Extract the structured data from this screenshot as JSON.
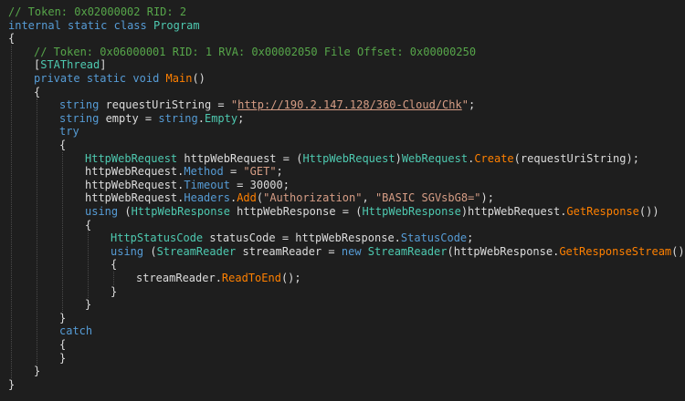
{
  "colors": {
    "background": "#1e1e1e",
    "comment": "#57a64a",
    "keyword": "#569cd6",
    "type": "#4ec9b0",
    "string": "#d69d85",
    "method": "#ff8000",
    "plain": "#dcdcdc"
  },
  "code": {
    "lines": [
      {
        "indent": 0,
        "tokens": [
          {
            "t": "// Token: 0x02000002 RID: 2",
            "c": "comment"
          }
        ]
      },
      {
        "indent": 0,
        "tokens": [
          {
            "t": "internal",
            "c": "keyword"
          },
          {
            "t": " ",
            "c": "plain"
          },
          {
            "t": "static",
            "c": "keyword"
          },
          {
            "t": " ",
            "c": "plain"
          },
          {
            "t": "class",
            "c": "keyword"
          },
          {
            "t": " ",
            "c": "plain"
          },
          {
            "t": "Program",
            "c": "type"
          }
        ]
      },
      {
        "indent": 0,
        "tokens": [
          {
            "t": "{",
            "c": "plain"
          }
        ]
      },
      {
        "indent": 1,
        "tokens": [
          {
            "t": "// Token: 0x06000001 RID: 1 RVA: 0x00002050 File Offset: 0x00000250",
            "c": "comment"
          }
        ]
      },
      {
        "indent": 1,
        "tokens": [
          {
            "t": "[",
            "c": "plain"
          },
          {
            "t": "STAThread",
            "c": "type"
          },
          {
            "t": "]",
            "c": "plain"
          }
        ]
      },
      {
        "indent": 1,
        "tokens": [
          {
            "t": "private",
            "c": "keyword"
          },
          {
            "t": " ",
            "c": "plain"
          },
          {
            "t": "static",
            "c": "keyword"
          },
          {
            "t": " ",
            "c": "plain"
          },
          {
            "t": "void",
            "c": "keyword"
          },
          {
            "t": " ",
            "c": "plain"
          },
          {
            "t": "Main",
            "c": "method"
          },
          {
            "t": "()",
            "c": "plain"
          }
        ]
      },
      {
        "indent": 1,
        "tokens": [
          {
            "t": "{",
            "c": "plain"
          }
        ]
      },
      {
        "indent": 2,
        "tokens": [
          {
            "t": "string",
            "c": "keyword"
          },
          {
            "t": " requestUriString = ",
            "c": "plain"
          },
          {
            "t": "\"",
            "c": "string"
          },
          {
            "t": "http://190.2.147.128/360-Cloud/Chk",
            "c": "url"
          },
          {
            "t": "\"",
            "c": "string"
          },
          {
            "t": ";",
            "c": "plain"
          }
        ]
      },
      {
        "indent": 2,
        "tokens": [
          {
            "t": "string",
            "c": "keyword"
          },
          {
            "t": " empty = ",
            "c": "plain"
          },
          {
            "t": "string",
            "c": "keyword"
          },
          {
            "t": ".",
            "c": "plain"
          },
          {
            "t": "Empty",
            "c": "type"
          },
          {
            "t": ";",
            "c": "plain"
          }
        ]
      },
      {
        "indent": 2,
        "tokens": [
          {
            "t": "try",
            "c": "keyword"
          }
        ]
      },
      {
        "indent": 2,
        "tokens": [
          {
            "t": "{",
            "c": "plain"
          }
        ]
      },
      {
        "indent": 3,
        "tokens": [
          {
            "t": "HttpWebRequest",
            "c": "type"
          },
          {
            "t": " httpWebRequest = (",
            "c": "plain"
          },
          {
            "t": "HttpWebRequest",
            "c": "type"
          },
          {
            "t": ")",
            "c": "plain"
          },
          {
            "t": "WebRequest",
            "c": "type"
          },
          {
            "t": ".",
            "c": "plain"
          },
          {
            "t": "Create",
            "c": "method"
          },
          {
            "t": "(requestUriString);",
            "c": "plain"
          }
        ]
      },
      {
        "indent": 3,
        "tokens": [
          {
            "t": "httpWebRequest.",
            "c": "plain"
          },
          {
            "t": "Method",
            "c": "keyword"
          },
          {
            "t": " = ",
            "c": "plain"
          },
          {
            "t": "\"GET\"",
            "c": "string"
          },
          {
            "t": ";",
            "c": "plain"
          }
        ]
      },
      {
        "indent": 3,
        "tokens": [
          {
            "t": "httpWebRequest.",
            "c": "plain"
          },
          {
            "t": "Timeout",
            "c": "keyword"
          },
          {
            "t": " = 30000;",
            "c": "plain"
          }
        ]
      },
      {
        "indent": 3,
        "tokens": [
          {
            "t": "httpWebRequest.",
            "c": "plain"
          },
          {
            "t": "Headers",
            "c": "keyword"
          },
          {
            "t": ".",
            "c": "plain"
          },
          {
            "t": "Add",
            "c": "method"
          },
          {
            "t": "(",
            "c": "plain"
          },
          {
            "t": "\"Authorization\"",
            "c": "string"
          },
          {
            "t": ", ",
            "c": "plain"
          },
          {
            "t": "\"BASIC SGVsbG8=\"",
            "c": "string"
          },
          {
            "t": ");",
            "c": "plain"
          }
        ]
      },
      {
        "indent": 3,
        "tokens": [
          {
            "t": "using",
            "c": "keyword"
          },
          {
            "t": " (",
            "c": "plain"
          },
          {
            "t": "HttpWebResponse",
            "c": "type"
          },
          {
            "t": " httpWebResponse = (",
            "c": "plain"
          },
          {
            "t": "HttpWebResponse",
            "c": "type"
          },
          {
            "t": ")httpWebRequest.",
            "c": "plain"
          },
          {
            "t": "GetResponse",
            "c": "method"
          },
          {
            "t": "())",
            "c": "plain"
          }
        ]
      },
      {
        "indent": 3,
        "tokens": [
          {
            "t": "{",
            "c": "plain"
          }
        ]
      },
      {
        "indent": 4,
        "tokens": [
          {
            "t": "HttpStatusCode",
            "c": "type"
          },
          {
            "t": " statusCode = httpWebResponse.",
            "c": "plain"
          },
          {
            "t": "StatusCode",
            "c": "keyword"
          },
          {
            "t": ";",
            "c": "plain"
          }
        ]
      },
      {
        "indent": 4,
        "tokens": [
          {
            "t": "using",
            "c": "keyword"
          },
          {
            "t": " (",
            "c": "plain"
          },
          {
            "t": "StreamReader",
            "c": "type"
          },
          {
            "t": " streamReader = ",
            "c": "plain"
          },
          {
            "t": "new",
            "c": "keyword"
          },
          {
            "t": " ",
            "c": "plain"
          },
          {
            "t": "StreamReader",
            "c": "type"
          },
          {
            "t": "(httpWebResponse.",
            "c": "plain"
          },
          {
            "t": "GetResponseStream",
            "c": "method"
          },
          {
            "t": "()))",
            "c": "plain"
          }
        ]
      },
      {
        "indent": 4,
        "tokens": [
          {
            "t": "{",
            "c": "plain"
          }
        ]
      },
      {
        "indent": 5,
        "tokens": [
          {
            "t": "streamReader.",
            "c": "plain"
          },
          {
            "t": "ReadToEnd",
            "c": "method"
          },
          {
            "t": "();",
            "c": "plain"
          }
        ]
      },
      {
        "indent": 4,
        "tokens": [
          {
            "t": "}",
            "c": "plain"
          }
        ]
      },
      {
        "indent": 3,
        "tokens": [
          {
            "t": "}",
            "c": "plain"
          }
        ]
      },
      {
        "indent": 2,
        "tokens": [
          {
            "t": "}",
            "c": "plain"
          }
        ]
      },
      {
        "indent": 2,
        "tokens": [
          {
            "t": "catch",
            "c": "keyword"
          }
        ]
      },
      {
        "indent": 2,
        "tokens": [
          {
            "t": "{",
            "c": "plain"
          }
        ]
      },
      {
        "indent": 2,
        "tokens": [
          {
            "t": "}",
            "c": "plain"
          }
        ]
      },
      {
        "indent": 1,
        "tokens": [
          {
            "t": "}",
            "c": "plain"
          }
        ]
      },
      {
        "indent": 0,
        "tokens": [
          {
            "t": "}",
            "c": "plain"
          }
        ]
      }
    ]
  }
}
